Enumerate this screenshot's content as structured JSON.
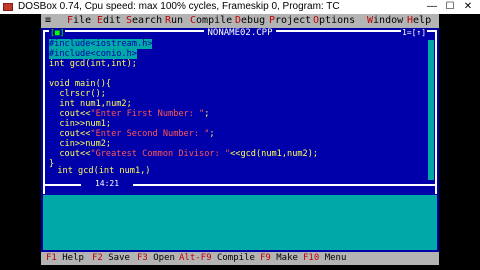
{
  "window": {
    "title": "DOSBox 0.74, Cpu speed: max 100% cycles, Frameskip  0, Program:    TC",
    "minimize": "—",
    "maximize": "☐",
    "close": "✕"
  },
  "menu": {
    "system": "≡",
    "items": [
      {
        "hot": "F",
        "rest": "ile"
      },
      {
        "hot": "E",
        "rest": "dit"
      },
      {
        "hot": "S",
        "rest": "earch"
      },
      {
        "hot": "R",
        "rest": "un"
      },
      {
        "hot": "C",
        "rest": "ompile"
      },
      {
        "hot": "D",
        "rest": "ebug"
      },
      {
        "hot": "P",
        "rest": "roject"
      },
      {
        "hot": "O",
        "rest": "ptions"
      },
      {
        "hot": "W",
        "rest": "indow"
      },
      {
        "hot": "H",
        "rest": "elp"
      }
    ]
  },
  "editor": {
    "close_button": "[■]",
    "filename": "NONAME02.CPP",
    "window_number": "1=[↑]",
    "cursor_position": "14:21",
    "lines": [
      {
        "text": "#include<iostream.h>",
        "selected": true
      },
      {
        "text": "#include<conio.h>",
        "selected": true
      },
      {
        "text": "int gcd(int,int);",
        "selected": false
      },
      {
        "text": "",
        "selected": false
      },
      {
        "text": "void main(){",
        "selected": false
      },
      {
        "text": "  clrscr();",
        "selected": false
      },
      {
        "text": "  int num1,num2;",
        "selected": false
      },
      {
        "pre": "  cout<<",
        "str": "\"Enter First Number: \"",
        "post": ";",
        "selected": false
      },
      {
        "text": "  cin>>num1;",
        "selected": false
      },
      {
        "pre": "  cout<<",
        "str": "\"Enter Second Number: \"",
        "post": ";",
        "selected": false
      },
      {
        "text": "  cin>>num2;",
        "selected": false
      },
      {
        "pre": "  cout<<",
        "str": "\"Greatest Common Divisor: \"",
        "post": "<<gcd(num1,num2);",
        "selected": false
      },
      {
        "text": "}",
        "selected": false
      },
      {
        "text": "",
        "selected": false
      },
      {
        "text": "  int gcd(int num1,)",
        "selected": false
      }
    ]
  },
  "statusbar": [
    {
      "key": "F1",
      "label": "Help"
    },
    {
      "key": "F2",
      "label": "Save"
    },
    {
      "key": "F3",
      "label": "Open"
    },
    {
      "key": "Alt-F9",
      "label": "Compile"
    },
    {
      "key": "F9",
      "label": "Make"
    },
    {
      "key": "F10",
      "label": "Menu"
    }
  ],
  "colors": {
    "editor_bg": "#0000aa",
    "code_text": "#ffff55",
    "string_text": "#ff5555",
    "selection_bg": "#00a8a8",
    "menu_bg": "#b4b4b4",
    "hotkey": "#c00000"
  }
}
